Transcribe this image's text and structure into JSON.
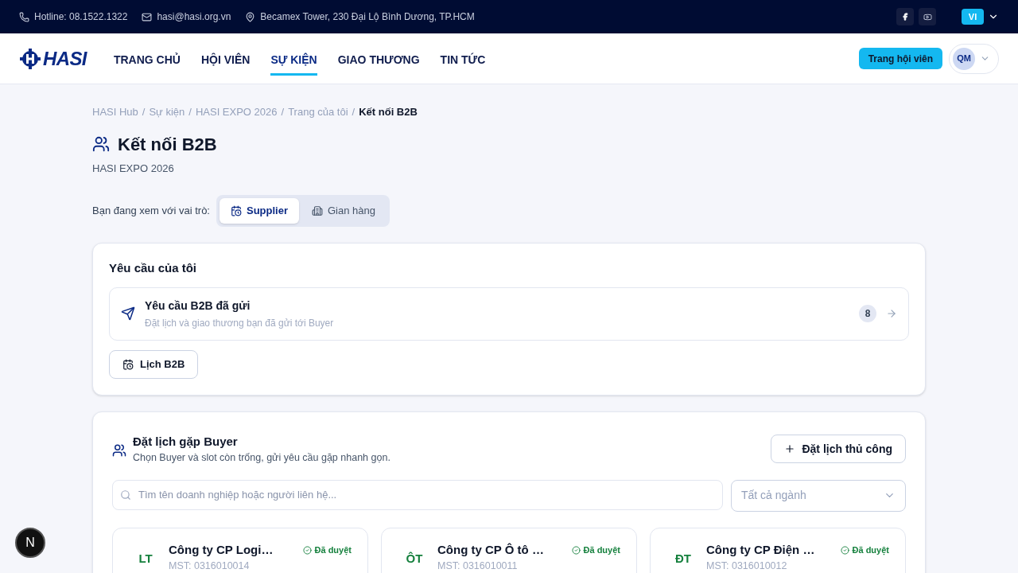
{
  "topbar": {
    "hotline": "Hotline: 08.1522.1322",
    "email": "hasi@hasi.org.vn",
    "address": "Becamex Tower, 230 Đại Lộ Bình Dương, TP.HCM",
    "language": "VI"
  },
  "header": {
    "logo": "HASI",
    "nav": [
      {
        "label": "TRANG CHỦ",
        "selected": false
      },
      {
        "label": "HỘI VIÊN",
        "selected": false
      },
      {
        "label": "SỰ KIỆN",
        "selected": true
      },
      {
        "label": "GIAO THƯƠNG",
        "selected": false
      },
      {
        "label": "TIN TỨC",
        "selected": false
      }
    ],
    "member_button": "Trang hội viên",
    "avatar": "QM"
  },
  "breadcrumb": [
    {
      "label": "HASI Hub",
      "current": false
    },
    {
      "separator": "/",
      "label": "Sự kiện",
      "current": false
    },
    {
      "separator": "/",
      "label": "HASI EXPO 2026",
      "current": false
    },
    {
      "separator": "/",
      "label": "Trang của tôi",
      "current": false
    },
    {
      "separator": "/",
      "label": "Kết nối B2B",
      "current": true
    }
  ],
  "page": {
    "title": "Kết nối B2B",
    "subtitle": "HASI EXPO 2026"
  },
  "role": {
    "label": "Bạn đang xem với vai trò:",
    "options": [
      {
        "label": "Supplier",
        "kind": "calendar",
        "selected": true
      },
      {
        "label": "Gian hàng",
        "kind": "building",
        "selected": false
      }
    ]
  },
  "requests": {
    "title": "Yêu cầu của tôi",
    "item": {
      "title": "Yêu cầu B2B đã gửi",
      "description": "Đặt lịch và giao thương bạn đã gửi tới Buyer",
      "count": "8"
    },
    "calendar_button": "Lịch B2B"
  },
  "booking": {
    "title": "Đặt lịch gặp Buyer",
    "subtitle": "Chọn Buyer và slot còn trống, gửi yêu cầu gặp nhanh gọn.",
    "manual_button": "Đặt lịch thủ công",
    "search_placeholder": "Tìm tên doanh nghiệp hoặc người liên hệ...",
    "industry_placeholder": "Tất cả ngành",
    "buyers": [
      {
        "initials": "LT",
        "name": "Công ty CP Logi…",
        "tax": "MST: 0316010014",
        "status": "Đã duyệt"
      },
      {
        "initials": "ÔT",
        "name": "Công ty CP Ô tô …",
        "tax": "MST: 0316010011",
        "status": "Đã duyệt"
      },
      {
        "initials": "ĐT",
        "name": "Công ty CP Điện …",
        "tax": "MST: 0316010012",
        "status": "Đã duyệt"
      }
    ]
  },
  "dev_badge": "N"
}
